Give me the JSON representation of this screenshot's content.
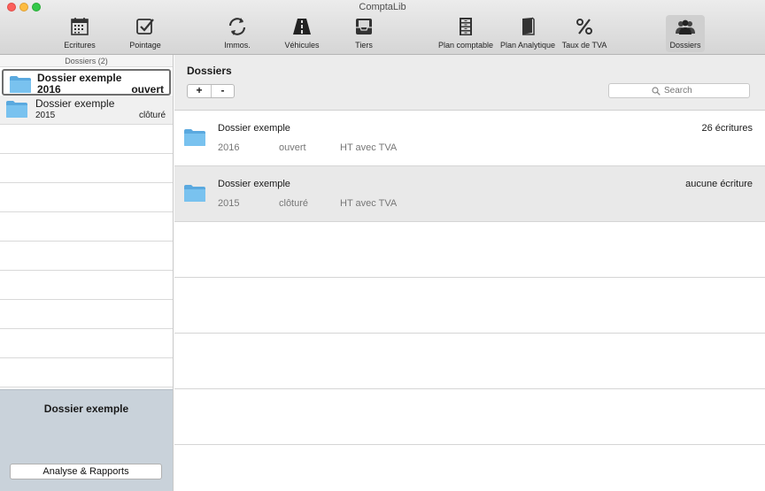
{
  "window": {
    "title": "ComptaLib"
  },
  "toolbar": {
    "items": [
      {
        "label": "Ecritures",
        "icon": "calendar-icon"
      },
      {
        "label": "Pointage",
        "icon": "checkbox-icon"
      },
      {
        "label": "Immos.",
        "icon": "refresh-icon"
      },
      {
        "label": "Véhicules",
        "icon": "road-icon"
      },
      {
        "label": "Tiers",
        "icon": "inbox-icon"
      },
      {
        "label": "Plan comptable",
        "icon": "cabinet-icon"
      },
      {
        "label": "Plan Analytique",
        "icon": "book-icon"
      },
      {
        "label": "Taux de TVA",
        "icon": "percent-icon"
      },
      {
        "label": "Dossiers",
        "icon": "users-icon"
      }
    ],
    "active": "Dossiers"
  },
  "sidebar": {
    "header": "Dossiers (2)",
    "items": [
      {
        "name": "Dossier exemple",
        "year": "2016",
        "status": "ouvert"
      },
      {
        "name": "Dossier exemple",
        "year": "2015",
        "status": "clôturé"
      }
    ],
    "footer": {
      "title": "Dossier exemple",
      "button": "Analyse & Rapports"
    }
  },
  "main": {
    "title": "Dossiers",
    "add_label": "+",
    "remove_label": "-",
    "search": {
      "placeholder": "Search",
      "value": ""
    },
    "rows": [
      {
        "name": "Dossier exemple",
        "year": "2016",
        "status": "ouvert",
        "tax": "HT avec TVA",
        "count": "26 écritures"
      },
      {
        "name": "Dossier exemple",
        "year": "2015",
        "status": "clôturé",
        "tax": "HT avec TVA",
        "count": "aucune écriture"
      }
    ]
  },
  "colors": {
    "folder": "#6fb8e8",
    "footer_bg": "#c9d2da",
    "close": "#fc605c",
    "minimize": "#fdbc40",
    "maximize": "#34c84a"
  }
}
